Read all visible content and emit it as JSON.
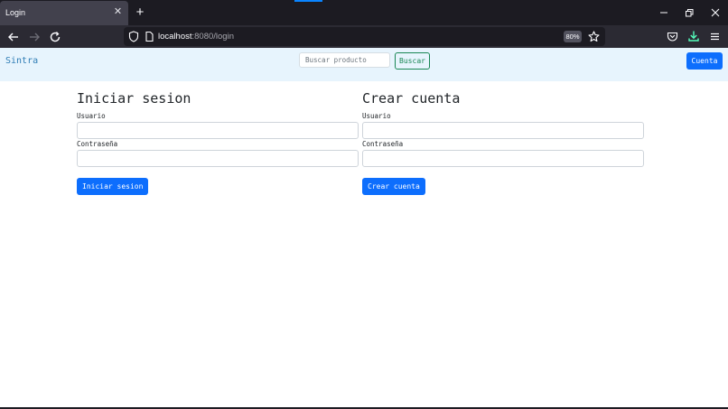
{
  "browser": {
    "tab_title": "Login",
    "url_host": "localhost",
    "url_rest": ":8080/login",
    "zoom": "80%"
  },
  "navbar": {
    "brand": "Sintra",
    "search_placeholder": "Buscar producto",
    "search_button": "Buscar",
    "account_button": "Cuenta"
  },
  "login": {
    "title": "Iniciar sesion",
    "username_label": "Usuario",
    "password_label": "Contraseña",
    "username_value": "",
    "password_value": "",
    "submit": "Iniciar sesion"
  },
  "register": {
    "title": "Crear cuenta",
    "username_label": "Usuario",
    "password_label": "Contraseña",
    "username_value": "",
    "password_value": "",
    "submit": "Crear cuenta"
  },
  "colors": {
    "navbar_bg": "#e7f4fd",
    "brand": "#2f7db5",
    "primary": "#0d6efd",
    "success": "#198754",
    "browser_chrome": "#2b2a33"
  }
}
